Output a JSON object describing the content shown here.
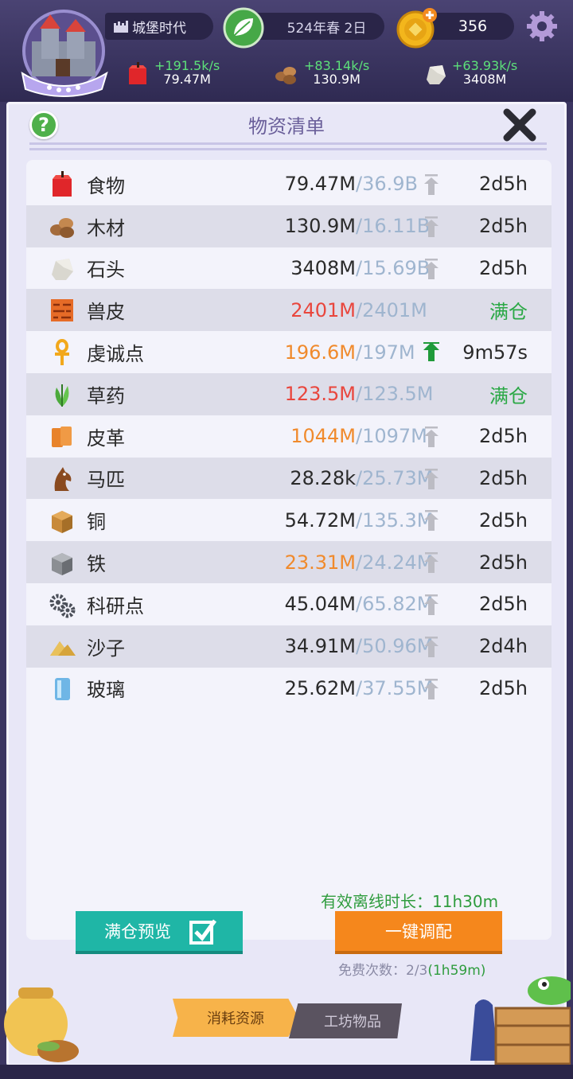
{
  "header": {
    "era_label": "城堡时代",
    "date_label": "524年春 2日",
    "coins": "356",
    "resources": [
      {
        "icon": "apple-icon",
        "rate": "+191.5k/s",
        "amount": "79.47M"
      },
      {
        "icon": "wood-icon",
        "rate": "+83.14k/s",
        "amount": "130.9M"
      },
      {
        "icon": "stone-icon",
        "rate": "+63.93k/s",
        "amount": "3408M"
      }
    ]
  },
  "panel": {
    "title": "物资清单",
    "help_label": "?",
    "rows": [
      {
        "icon": "apple-icon",
        "name": "食物",
        "amount": "79.47M",
        "cap": "/36.9B",
        "arrow": "gray",
        "time": "2d5h",
        "amt_color": ""
      },
      {
        "icon": "wood-icon",
        "name": "木材",
        "amount": "130.9M",
        "cap": "/16.11B",
        "arrow": "gray",
        "time": "2d5h",
        "amt_color": ""
      },
      {
        "icon": "stone-icon",
        "name": "石头",
        "amount": "3408M",
        "cap": "/15.69B",
        "arrow": "gray",
        "time": "2d5h",
        "amt_color": ""
      },
      {
        "icon": "hide-icon",
        "name": "兽皮",
        "amount": "2401M",
        "cap": "/2401M",
        "arrow": "none",
        "time": "满仓",
        "amt_color": "red"
      },
      {
        "icon": "ankh-icon",
        "name": "虔诚点",
        "amount": "196.6M",
        "cap": "/197M",
        "arrow": "green",
        "time": "9m57s",
        "amt_color": "orange"
      },
      {
        "icon": "herb-icon",
        "name": "草药",
        "amount": "123.5M",
        "cap": "/123.5M",
        "arrow": "none",
        "time": "满仓",
        "amt_color": "red"
      },
      {
        "icon": "leather-icon",
        "name": "皮革",
        "amount": "1044M",
        "cap": "/1097M",
        "arrow": "gray",
        "time": "2d5h",
        "amt_color": "orange"
      },
      {
        "icon": "horse-icon",
        "name": "马匹",
        "amount": "28.28k",
        "cap": "/25.73M",
        "arrow": "gray",
        "time": "2d5h",
        "amt_color": ""
      },
      {
        "icon": "copper-icon",
        "name": "铜",
        "amount": "54.72M",
        "cap": "/135.3M",
        "arrow": "gray",
        "time": "2d5h",
        "amt_color": ""
      },
      {
        "icon": "iron-icon",
        "name": "铁",
        "amount": "23.31M",
        "cap": "/24.24M",
        "arrow": "gray",
        "time": "2d5h",
        "amt_color": "orange"
      },
      {
        "icon": "research-gears-icon",
        "name": "科研点",
        "amount": "45.04M",
        "cap": "/65.82M",
        "arrow": "gray",
        "time": "2d5h",
        "amt_color": ""
      },
      {
        "icon": "sand-icon",
        "name": "沙子",
        "amount": "34.91M",
        "cap": "/50.96M",
        "arrow": "gray",
        "time": "2d4h",
        "amt_color": ""
      },
      {
        "icon": "glass-icon",
        "name": "玻璃",
        "amount": "25.62M",
        "cap": "/37.55M",
        "arrow": "gray",
        "time": "2d5h",
        "amt_color": ""
      }
    ],
    "offline_label": "有效离线时长：11h30m",
    "preview_button": "满仓预览",
    "alloc_button": "一键调配",
    "free_label": "免费次数：2/3",
    "free_timer": "(1h59m)",
    "tabs": [
      "消耗资源",
      "工坊物品"
    ]
  }
}
